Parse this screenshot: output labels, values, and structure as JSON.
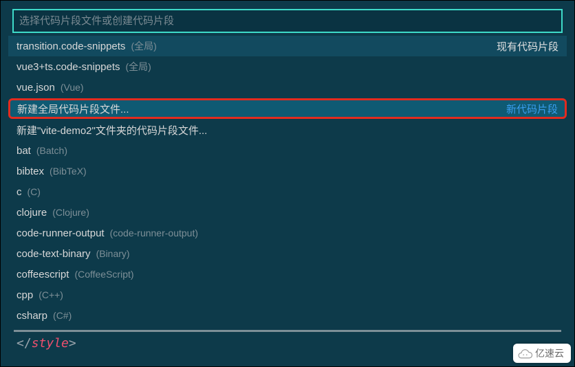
{
  "input": {
    "placeholder": "选择代码片段文件或创建代码片段",
    "value": ""
  },
  "sections": {
    "existing_label": "现有代码片段",
    "new_label": "新代码片段"
  },
  "items": [
    {
      "main": "transition.code-snippets",
      "sub": "(全局)",
      "right": "existing",
      "state": "selected"
    },
    {
      "main": "vue3+ts.code-snippets",
      "sub": "(全局)",
      "right": "",
      "state": ""
    },
    {
      "main": "vue.json",
      "sub": "(Vue)",
      "right": "",
      "state": ""
    },
    {
      "main": "新建全局代码片段文件...",
      "sub": "",
      "right": "new",
      "state": "highlighted"
    },
    {
      "main": "新建\"vite-demo2\"文件夹的代码片段文件...",
      "sub": "",
      "right": "",
      "state": ""
    },
    {
      "main": "bat",
      "sub": "(Batch)",
      "right": "",
      "state": ""
    },
    {
      "main": "bibtex",
      "sub": "(BibTeX)",
      "right": "",
      "state": ""
    },
    {
      "main": "c",
      "sub": "(C)",
      "right": "",
      "state": ""
    },
    {
      "main": "clojure",
      "sub": "(Clojure)",
      "right": "",
      "state": ""
    },
    {
      "main": "code-runner-output",
      "sub": "(code-runner-output)",
      "right": "",
      "state": ""
    },
    {
      "main": "code-text-binary",
      "sub": "(Binary)",
      "right": "",
      "state": ""
    },
    {
      "main": "coffeescript",
      "sub": "(CoffeeScript)",
      "right": "",
      "state": ""
    },
    {
      "main": "cpp",
      "sub": "(C++)",
      "right": "",
      "state": ""
    },
    {
      "main": "csharp",
      "sub": "(C#)",
      "right": "",
      "state": ""
    }
  ],
  "code": {
    "open": "</",
    "tag": "style",
    "close": ">"
  },
  "watermark": "亿速云"
}
